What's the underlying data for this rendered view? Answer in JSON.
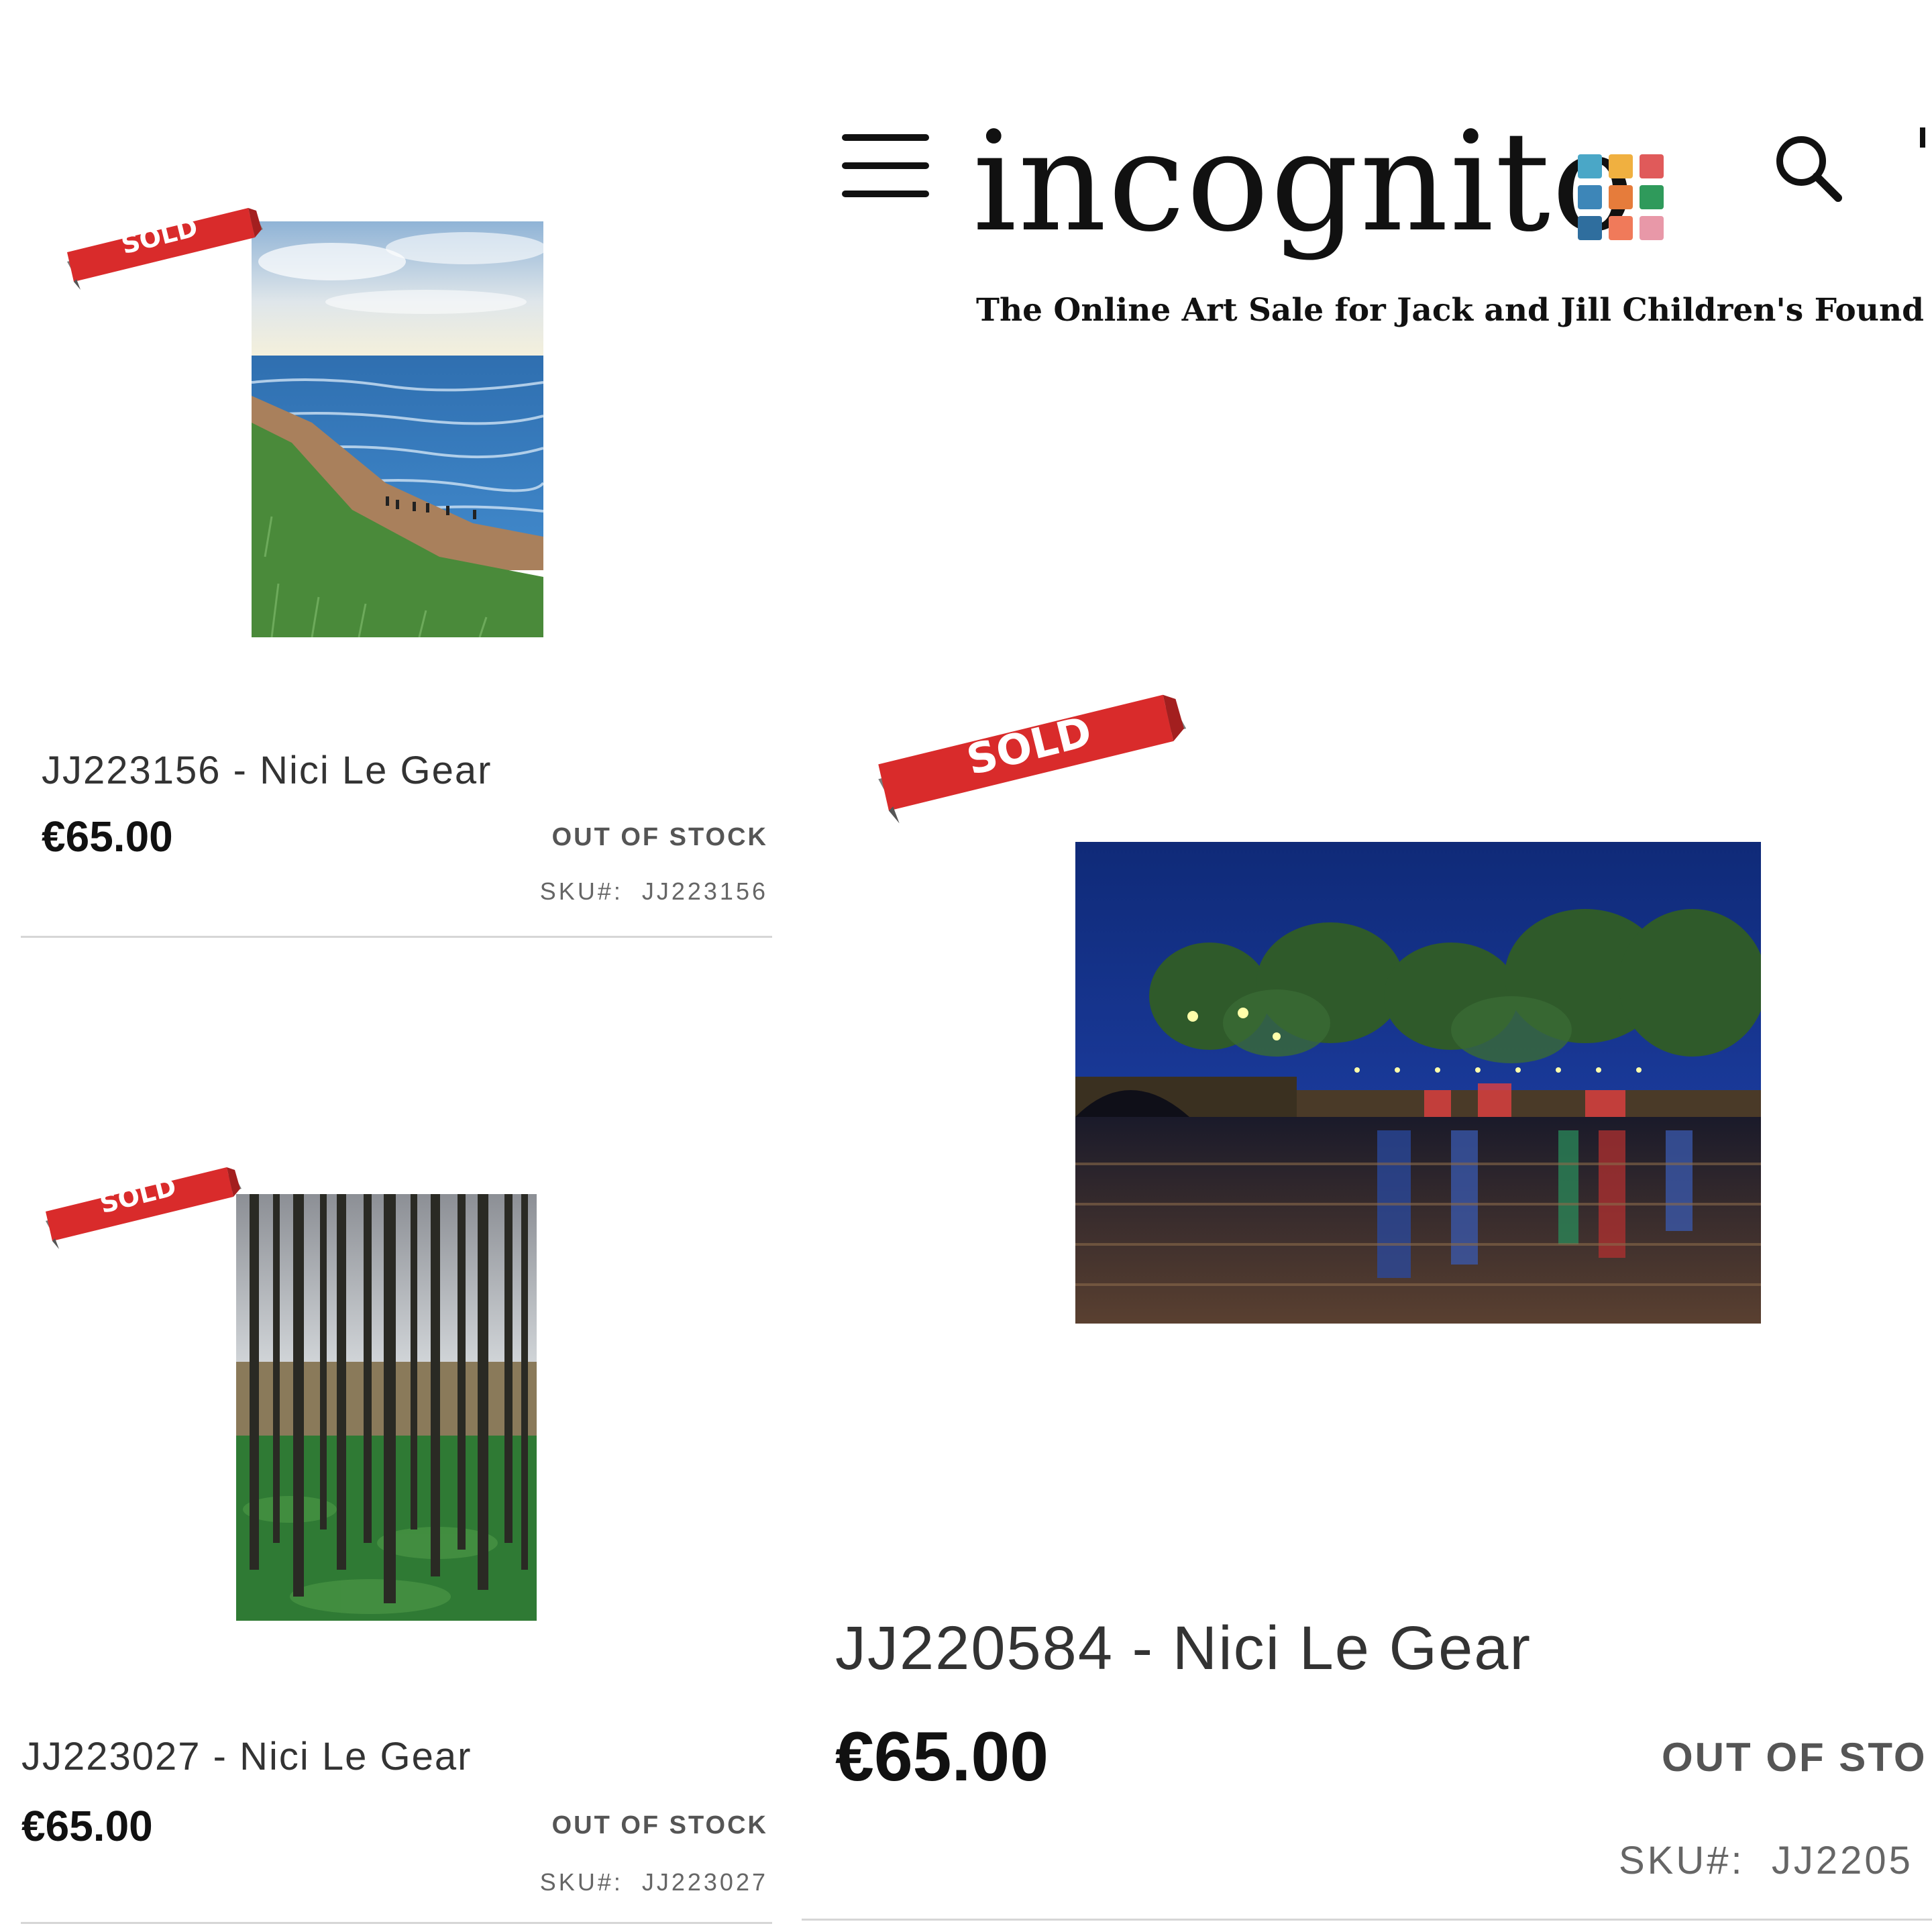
{
  "header": {
    "logo_text": "incognito",
    "tagline": "The Online Art Sale for Jack and Jill Children's Found",
    "logo_colors": [
      "#4aa7c7",
      "#f0b040",
      "#e05a5a",
      "#3d86b8",
      "#e67c3b",
      "#2f9a5b",
      "#2f6e9e",
      "#f07a5a",
      "#e898a8"
    ]
  },
  "badge_text": "SOLD",
  "products": [
    {
      "title": "JJ223156 - Nici Le Gear",
      "price": "€65.00",
      "stock": "OUT OF STOCK",
      "sku_label": "SKU#:",
      "sku_value": "JJ223156"
    },
    {
      "title": "JJ223027 - Nici Le Gear",
      "price": "€65.00",
      "stock": "OUT OF STOCK",
      "sku_label": "SKU#:",
      "sku_value": "JJ223027"
    },
    {
      "title": "JJ220584 - Nici Le Gear",
      "price": "€65.00",
      "stock": "OUT OF STO",
      "sku_label": "SKU#:",
      "sku_value": "JJ2205"
    }
  ],
  "colors": {
    "badge_red": "#d92b2b",
    "badge_shadow": "#7a7a7a"
  }
}
